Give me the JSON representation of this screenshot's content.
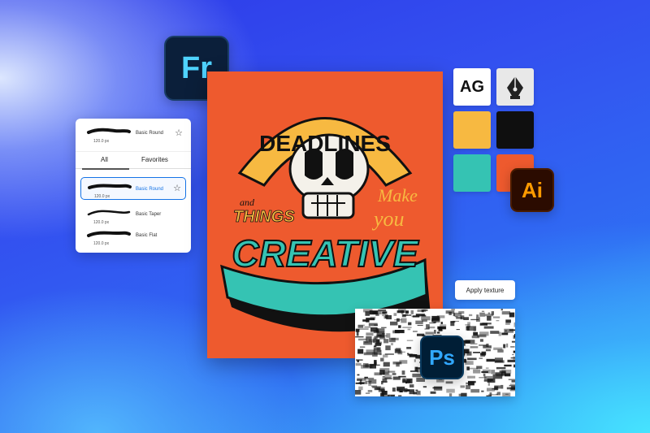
{
  "apps": {
    "fresco": "Fr",
    "illustrator": "Ai",
    "photoshop": "Ps"
  },
  "brushes": {
    "top_row": {
      "size": "120.0 px",
      "name": "Basic Round"
    },
    "tabs": {
      "all": "All",
      "favorites": "Favorites"
    },
    "items": [
      {
        "size": "120.0 px",
        "name": "Basic Round",
        "selected": true
      },
      {
        "size": "120.0 px",
        "name": "Basic Taper",
        "selected": false
      },
      {
        "size": "120.0 px",
        "name": "Basic Flat",
        "selected": false
      }
    ]
  },
  "poster": {
    "line1": "DEADLINES",
    "line2a": "and",
    "line2b": "THINGS",
    "line3a": "Make",
    "line3b": "you",
    "line4": "CREATIVE"
  },
  "swatches": {
    "type_tool_label": "AG",
    "pen_icon": "pen-tool-icon",
    "colors": [
      "#f7b941",
      "#0f0f0f",
      "#35c3b3",
      "#ee5a2e"
    ]
  },
  "texture": {
    "button_label": "Apply texture"
  }
}
